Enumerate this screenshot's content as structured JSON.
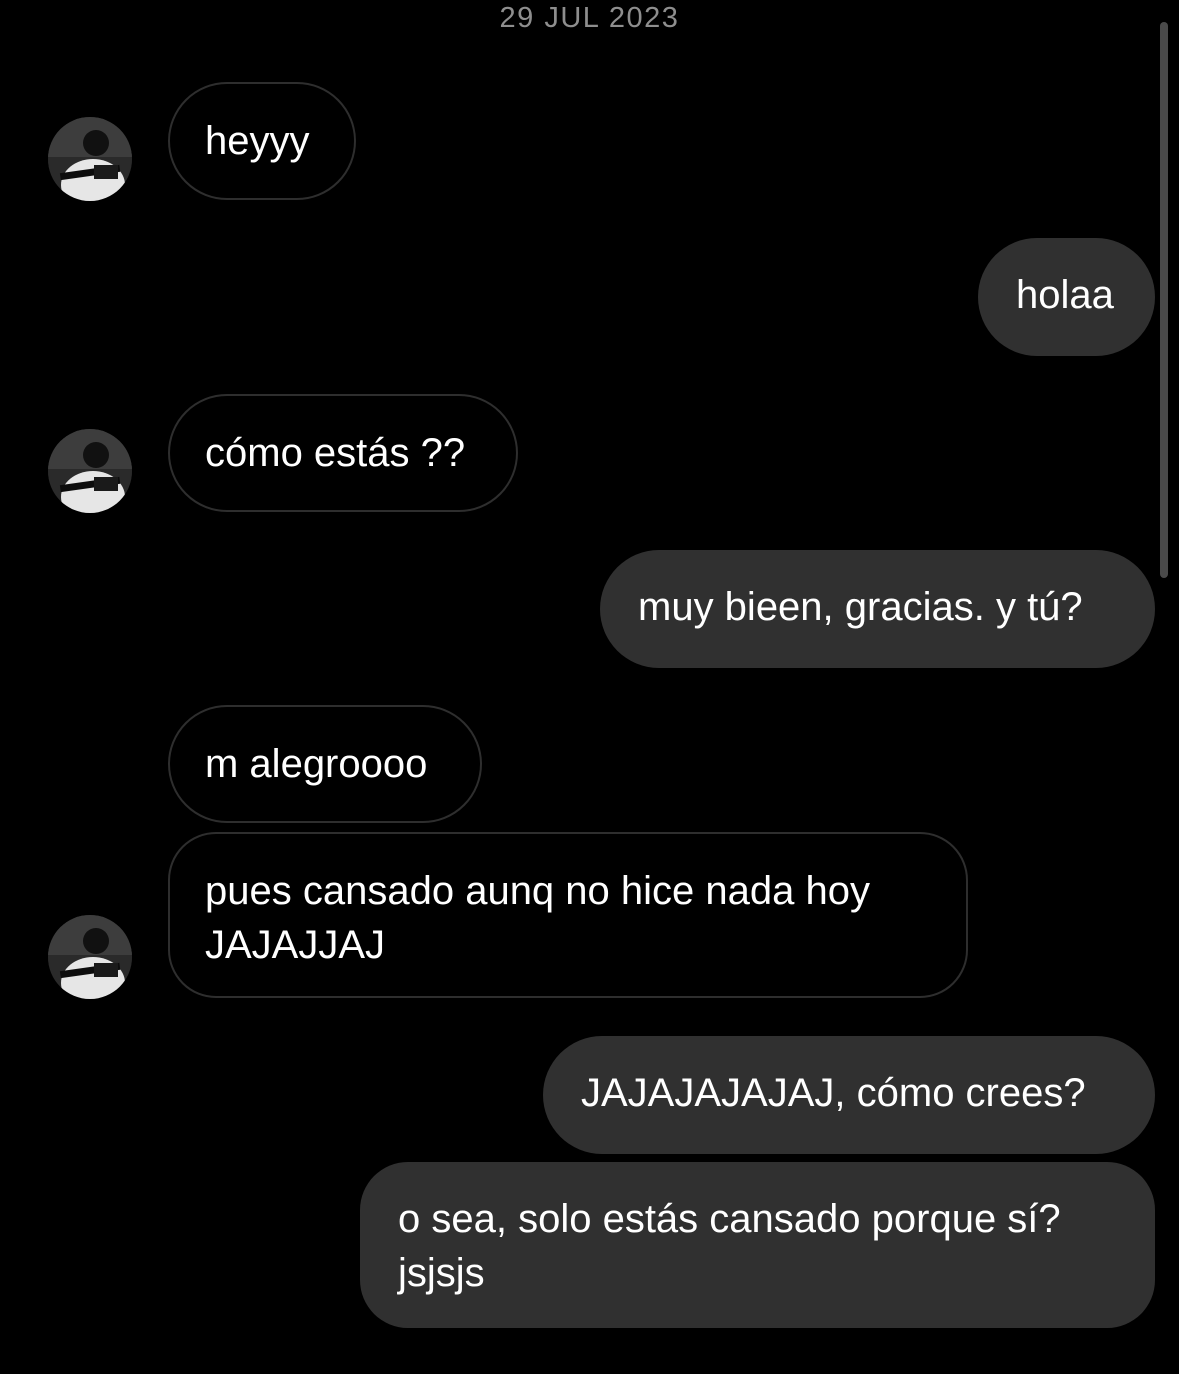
{
  "conversation": {
    "date_header": "29 JUL 2023",
    "messages": [
      {
        "sender": "them",
        "text": "heyyy"
      },
      {
        "sender": "me",
        "text": "holaa"
      },
      {
        "sender": "them",
        "text": "cómo estás ??"
      },
      {
        "sender": "me",
        "text": "muy bieen, gracias. y tú?"
      },
      {
        "sender": "them",
        "text": "m alegroooo"
      },
      {
        "sender": "them",
        "text": "pues cansado aunq no hice nada hoy\nJAJAJJAJ"
      },
      {
        "sender": "me",
        "text": "JAJAJAJAJAJ, cómo crees?"
      },
      {
        "sender": "me",
        "text": "o sea, solo estás cansado porque sí?\njsjsjs"
      }
    ]
  },
  "colors": {
    "background": "#000000",
    "outgoing_bubble": "#303030",
    "incoming_border": "#2e2e2e",
    "date_text": "#8e8e8e"
  },
  "icons": {
    "avatar": "contact-avatar-photo"
  }
}
